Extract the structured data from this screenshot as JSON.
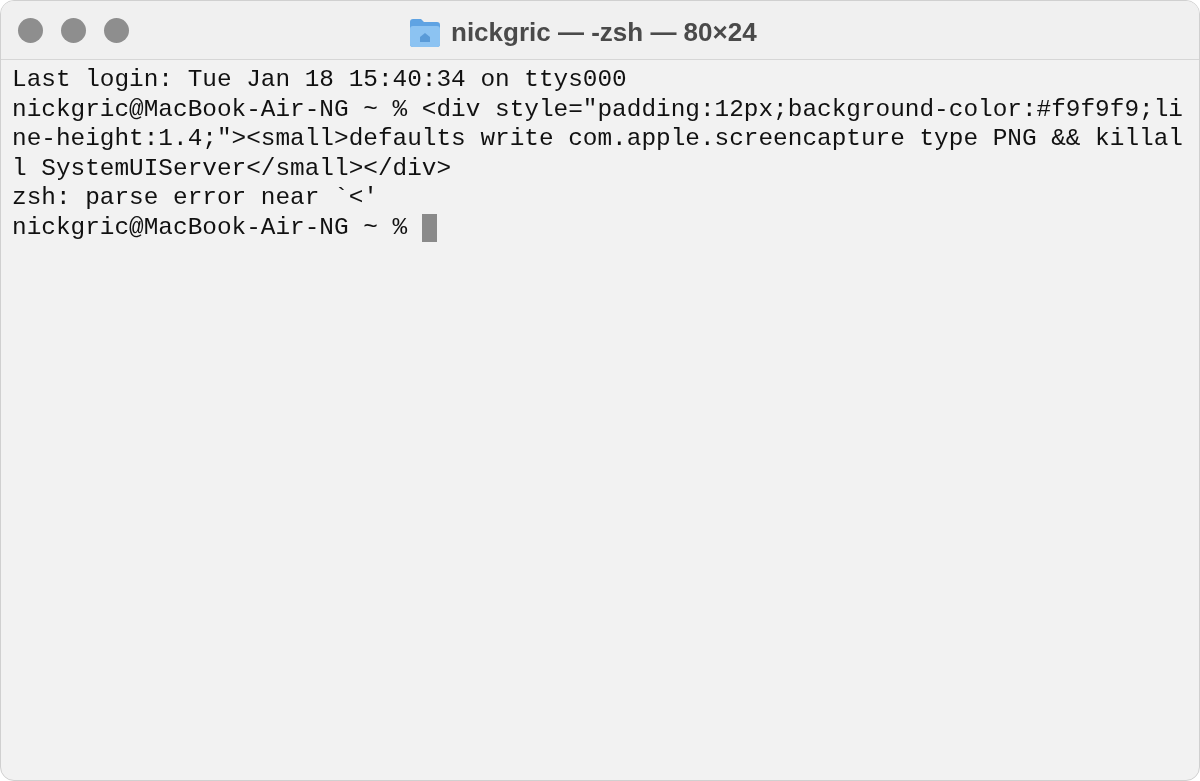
{
  "window": {
    "title": "nickgric — -zsh — 80×24"
  },
  "terminal": {
    "lines": [
      "Last login: Tue Jan 18 15:40:34 on ttys000",
      "nickgric@MacBook-Air-NG ~ % <div style=\"padding:12px;background-color:#f9f9f9;li",
      "ne-height:1.4;\"><small>defaults write com.apple.screencapture type PNG && killal",
      "l SystemUIServer</small></div>",
      "zsh: parse error near `<'",
      "nickgric@MacBook-Air-NG ~ % "
    ],
    "cursor": true
  }
}
